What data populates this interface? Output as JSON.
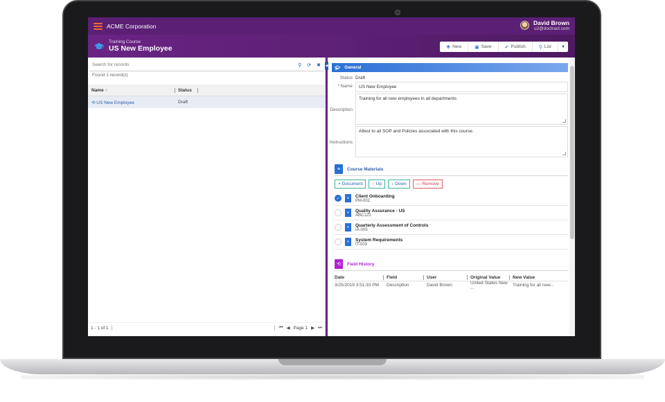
{
  "header": {
    "company": "ACME Corporation",
    "user_name": "David Brown",
    "user_email": "u2@doctract.com"
  },
  "titlebar": {
    "subtitle": "Training Course",
    "title": "US New Employee"
  },
  "toolbar": {
    "new_label": "New",
    "save_label": "Save",
    "publish_label": "Publish",
    "list_label": "List"
  },
  "left": {
    "search_placeholder": "Search for records",
    "found": "Found 1 record(s)",
    "col_name": "Name ↑",
    "col_status": "Status",
    "rows": [
      {
        "name": "US New Employee",
        "status": "Draft"
      }
    ],
    "pager_count": "1 - 1 of 1",
    "pager_page": "Page 1"
  },
  "general": {
    "section_title": "General",
    "status_label": "Status",
    "status_value": "Draft",
    "name_label": "* Name",
    "name_value": "US New Employee",
    "description_label": "Description",
    "description_value": "Training for all new employees in all departments",
    "instructions_label": "Instructions",
    "instructions_value": "Attest to all SOP and Policies associated with this course."
  },
  "materials": {
    "title": "Course Materials",
    "btn_document": "Document",
    "btn_up": "Up",
    "btn_down": "Down",
    "btn_remove": "Remove",
    "items": [
      {
        "name": "Client Onboarding",
        "code": "PM-002",
        "checked": true
      },
      {
        "name": "Quality Assurance - US",
        "code": "ABC123",
        "checked": false
      },
      {
        "name": "Quarterly Assessment of Controls",
        "code": "IA-005",
        "checked": false
      },
      {
        "name": "System Requirements",
        "code": "IT-003",
        "checked": false
      }
    ]
  },
  "history": {
    "title": "Field History",
    "col_date": "Date",
    "col_field": "Field",
    "col_user": "User",
    "col_original": "Original Value",
    "col_new": "New Value",
    "rows": [
      {
        "date": "3/25/2019 3:51:33 PM",
        "field": "Description",
        "user": "David Brown",
        "original": "United States New ...",
        "new": "Training for all new..."
      }
    ]
  },
  "colors": {
    "header_purple": "#5b1f74",
    "accent_blue": "#2b6fd6",
    "history_magenta": "#b51fd8"
  }
}
